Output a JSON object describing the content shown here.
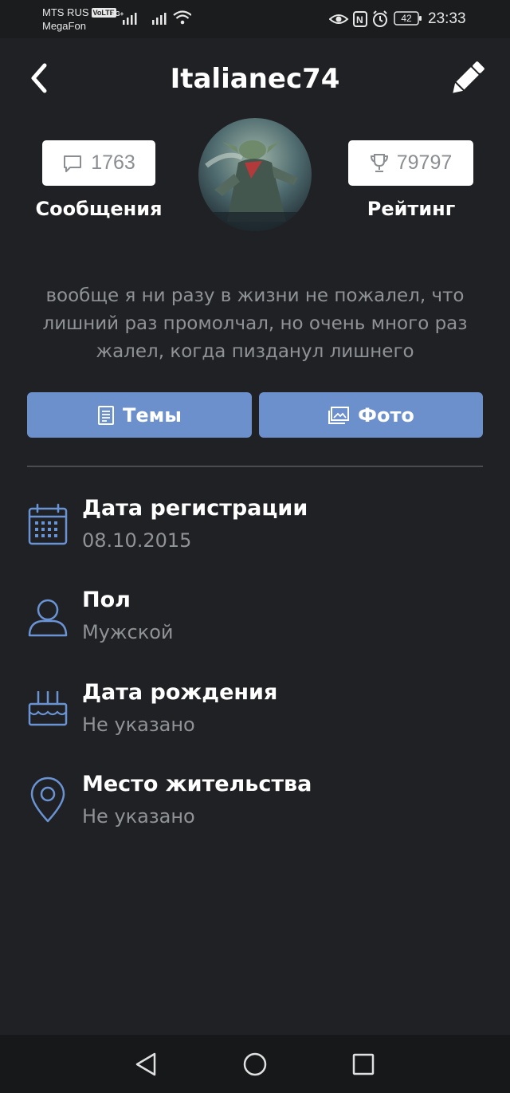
{
  "status_bar": {
    "carrier_1": "MTS RUS",
    "volte": "VoLTE",
    "carrier_2": "MegaFon",
    "network": "4G+",
    "battery": "42",
    "time": "23:33"
  },
  "header": {
    "username": "Italianec74"
  },
  "stats": {
    "messages_count": "1763",
    "messages_label": "Сообщения",
    "rating_value": "79797",
    "rating_label": "Рейтинг"
  },
  "profile": {
    "status_text": "вообще я ни разу в жизни не пожалел, что лишний раз промолчал, но очень много раз жалел, когда пизданул лишнего"
  },
  "buttons": {
    "topics": "Темы",
    "photos": "Фото"
  },
  "info": [
    {
      "label": "Дата регистрации",
      "value": "08.10.2015",
      "icon": "calendar-icon"
    },
    {
      "label": "Пол",
      "value": "Мужской",
      "icon": "person-icon"
    },
    {
      "label": "Дата рождения",
      "value": "Не указано",
      "icon": "cake-icon"
    },
    {
      "label": "Место жительства",
      "value": "Не указано",
      "icon": "location-pin-icon"
    }
  ],
  "colors": {
    "background": "#202124",
    "accent": "#6c90cc",
    "icon_blue": "#6a93d4",
    "muted_text": "#8f9296"
  }
}
